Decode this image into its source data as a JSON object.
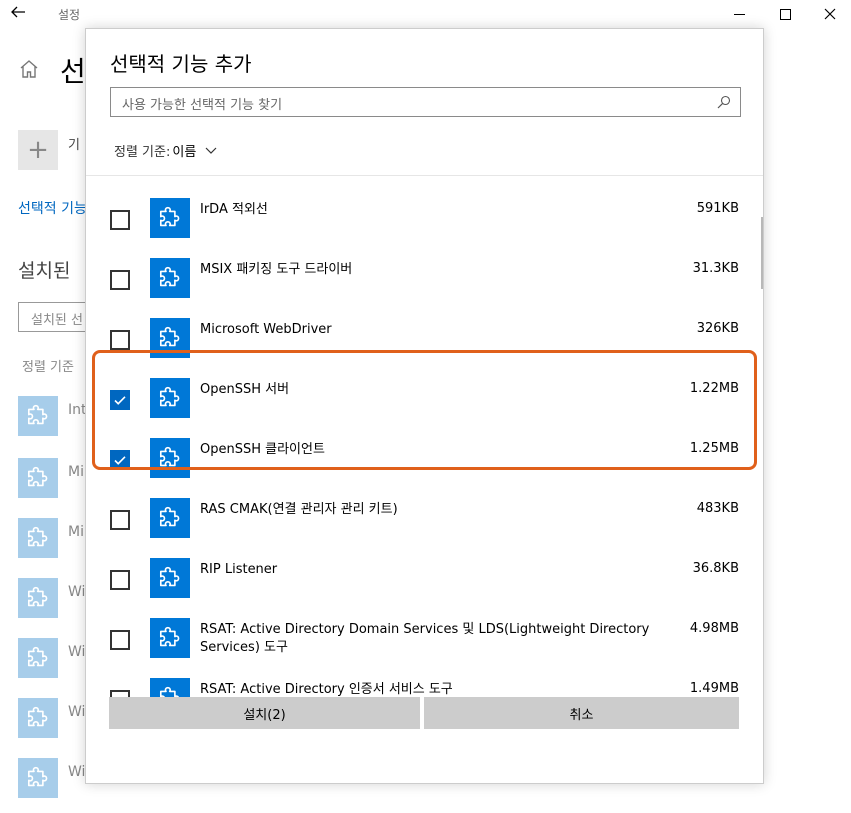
{
  "window": {
    "title": "설정",
    "back_icon": "back-arrow-icon",
    "controls": [
      "minimize-icon",
      "maximize-icon",
      "close-icon"
    ]
  },
  "background": {
    "heading": "선",
    "add_label": "기",
    "link_text": "선택적 기능",
    "installed_heading": "설치된",
    "search_placeholder": "설치된 선",
    "sort_label": "정렬 기준",
    "items": [
      "Int",
      "Mi",
      "Mi",
      "Wi",
      "Wi",
      "Wi",
      "Wi"
    ]
  },
  "dialog": {
    "title": "선택적 기능 추가",
    "search_placeholder": "사용 가능한 선택적 기능 찾기",
    "sort_label": "정렬 기준:",
    "sort_value": "이름",
    "features": [
      {
        "name": "IrDA 적외선",
        "size": "591KB",
        "checked": false
      },
      {
        "name": "MSIX 패키징 도구 드라이버",
        "size": "31.3KB",
        "checked": false
      },
      {
        "name": "Microsoft WebDriver",
        "size": "326KB",
        "checked": false
      },
      {
        "name": "OpenSSH 서버",
        "size": "1.22MB",
        "checked": true
      },
      {
        "name": "OpenSSH 클라이언트",
        "size": "1.25MB",
        "checked": true
      },
      {
        "name": "RAS CMAK(연결 관리자 관리 키트)",
        "size": "483KB",
        "checked": false
      },
      {
        "name": "RIP Listener",
        "size": "36.8KB",
        "checked": false
      },
      {
        "name": "RSAT: Active Directory Domain Services 및 LDS(Lightweight Directory Services) 도구",
        "size": "4.98MB",
        "checked": false
      },
      {
        "name": "RSAT: Active Directory 인증서 서비스 도구",
        "size": "1.49MB",
        "checked": false
      }
    ],
    "install_button": "설치(2)",
    "cancel_button": "취소"
  },
  "colors": {
    "accent": "#0078d7",
    "checkbox_checked": "#0067c0",
    "highlight": "#e0601b",
    "button_bg": "#cccccc",
    "link": "#0067c0"
  }
}
